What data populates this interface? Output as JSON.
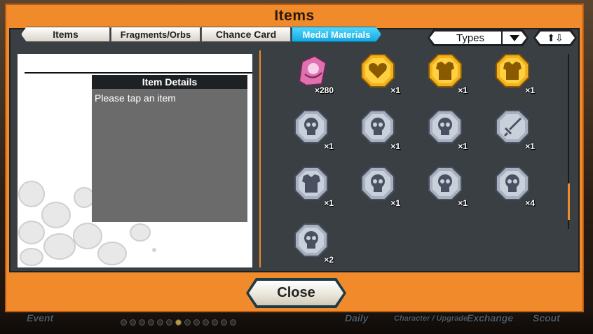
{
  "window": {
    "title": "Items"
  },
  "tabs": [
    {
      "label": "Items",
      "active": false
    },
    {
      "label": "Fragments/Orbs",
      "active": false
    },
    {
      "label": "Chance Card",
      "active": false
    },
    {
      "label": "Medal Materials",
      "active": true
    }
  ],
  "filter": {
    "types_label": "Types",
    "sort_label": "⬆⇩"
  },
  "details": {
    "header": "Item Details",
    "placeholder": "Please tap an item"
  },
  "items": [
    {
      "icon": "pink-character-medal-icon",
      "count": "×280"
    },
    {
      "icon": "gold-heart-medal-icon",
      "count": "×1"
    },
    {
      "icon": "gold-armor-medal-icon",
      "count": "×1"
    },
    {
      "icon": "gold-armor-medal-icon",
      "count": "×1"
    },
    {
      "icon": "silver-skull-medal-icon",
      "count": "×1"
    },
    {
      "icon": "silver-skull-medal-icon",
      "count": "×1"
    },
    {
      "icon": "silver-skull-medal-icon",
      "count": "×1"
    },
    {
      "icon": "silver-sword-medal-icon",
      "count": "×1"
    },
    {
      "icon": "silver-armor-medal-icon",
      "count": "×1"
    },
    {
      "icon": "silver-skull-medal-icon",
      "count": "×1"
    },
    {
      "icon": "silver-skull-medal-icon",
      "count": "×1"
    },
    {
      "icon": "silver-skull-medal-icon",
      "count": "×4"
    },
    {
      "icon": "silver-skull-medal-icon",
      "count": "×2"
    }
  ],
  "close_label": "Close",
  "bottom_nav": [
    "Event",
    "Daily",
    "Character / Upgrade",
    "Exchange",
    "Scout"
  ],
  "colors": {
    "frame": "#f08a2a",
    "tab_active": "#16a8e0",
    "gold": "#f0b020",
    "silver": "#a8b0c0",
    "pink": "#e070b0"
  }
}
